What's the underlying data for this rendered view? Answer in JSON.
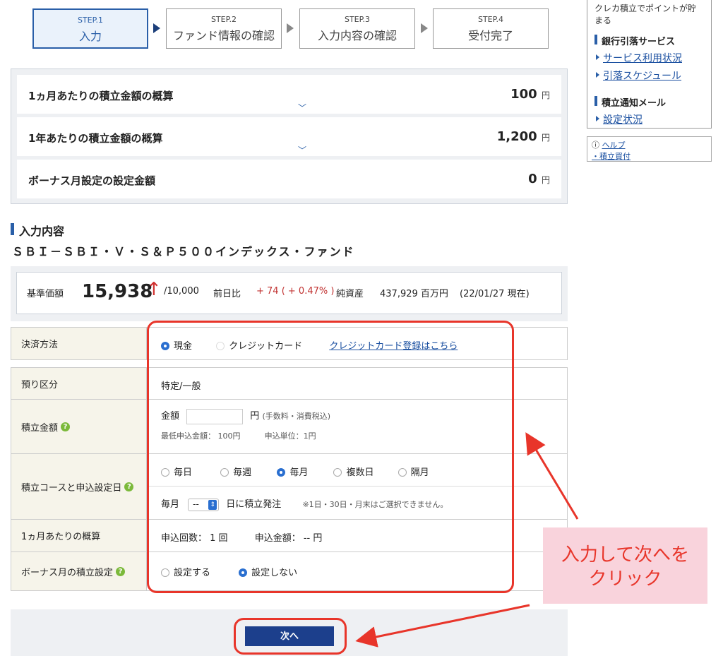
{
  "steps": [
    {
      "num": "STEP.1",
      "name": "入力"
    },
    {
      "num": "STEP.2",
      "name": "ファンド情報の確認"
    },
    {
      "num": "STEP.3",
      "name": "入力内容の確認"
    },
    {
      "num": "STEP.4",
      "name": "受付完了"
    }
  ],
  "sidebar": {
    "promo": "クレカ積立でポイントが貯まる",
    "sections": [
      {
        "title": "銀行引落サービス",
        "links": [
          "サービス利用状況",
          "引落スケジュール"
        ]
      },
      {
        "title": "積立通知メール",
        "links": [
          "設定状況"
        ]
      }
    ],
    "help": {
      "label": "ヘルプ",
      "link": "・積立買付"
    }
  },
  "summary": [
    {
      "label": "1ヵ月あたりの積立金額の概算",
      "value": "100",
      "unit": "円"
    },
    {
      "label": "1年あたりの積立金額の概算",
      "value": "1,200",
      "unit": "円"
    },
    {
      "label": "ボーナス月設定の設定金額",
      "value": "0",
      "unit": "円"
    }
  ],
  "section": {
    "title": "入力内容",
    "fund_name": "ＳＢＩ－ＳＢＩ・Ｖ・Ｓ＆Ｐ５００インデックス・ファンド"
  },
  "price": {
    "base_label": "基準価額",
    "base_value": "15,938",
    "unit": "/10,000",
    "diff_label": "前日比",
    "diff": "+ 74 ( + 0.47% )",
    "nav_label": "純資産",
    "nav_value": "437,929 百万円",
    "as_of": "(22/01/27 現在)"
  },
  "form": {
    "payment": {
      "label": "決済方法",
      "options": [
        "現金",
        "クレジットカード"
      ],
      "selected": "現金",
      "link": "クレジットカード登録はこちら"
    },
    "account": {
      "label": "預り区分",
      "value": "特定/一般"
    },
    "amount": {
      "label": "積立金額",
      "field_label": "金額",
      "unit": "円",
      "unit_note": "(手数料・消費税込)",
      "min": "最低申込金額： 100円",
      "step": "申込単位：1円"
    },
    "course": {
      "label": "積立コースと申込設定日",
      "options": [
        "毎日",
        "毎週",
        "毎月",
        "複数日",
        "隔月"
      ],
      "selected": "毎月",
      "day_prefix": "毎月",
      "day_value": "--",
      "day_suffix": "日に積立発注",
      "day_note": "※1日・30日・月末はご選択できません。"
    },
    "monthly": {
      "label": "1ヵ月あたりの概算",
      "count": "申込回数： 1 回",
      "amount": "申込金額： -- 円"
    },
    "bonus": {
      "label": "ボーナス月の積立設定",
      "options": [
        "設定する",
        "設定しない"
      ],
      "selected": "設定しない"
    }
  },
  "next_button": "次へ",
  "annotation": {
    "line1": "入力して次へを",
    "line2": "クリック"
  },
  "colors": {
    "accent": "#2a5fa8",
    "annotation": "#e8352a",
    "note_bg": "#f9d3dc"
  }
}
